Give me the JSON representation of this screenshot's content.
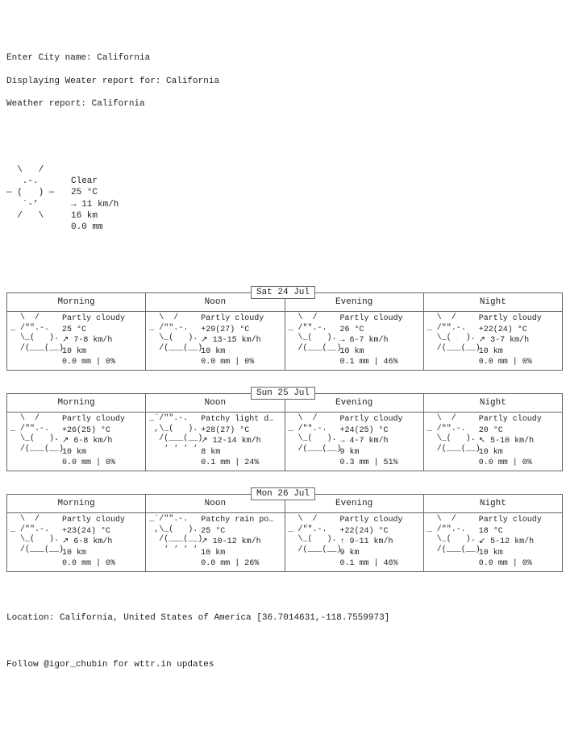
{
  "input_prompt": "Enter City name: ",
  "input_value": "California",
  "displaying_line": "Displaying Weater report for: California",
  "report_line": "Weather report: California",
  "current": {
    "art_lines": [
      "  \\   /",
      "   .-.",
      "― (   ) ―",
      "   `-’",
      "  /   \\"
    ],
    "cond": "Clear",
    "temp": "25 °C",
    "wind": "→ 11 km/h",
    "vis": "16 km",
    "precip": "0.0 mm"
  },
  "period_labels": [
    "Morning",
    "Noon",
    "Evening",
    "Night"
  ],
  "art_partly": [
    "  \\  /",
    "_ /\"\".-.",
    "  \\_(   ).",
    "  /(___(__)"
  ],
  "art_patchy": [
    "_`/\"\".-.",
    " ,\\_(   ).",
    "  /(___(__)",
    "   ‘ ‘ ‘ ‘"
  ],
  "days": [
    {
      "date": "Sat 24 Jul",
      "periods": [
        {
          "art": "partly",
          "cond": "Partly cloudy",
          "temp": "25 °C",
          "wind": "↗ 7-8 km/h",
          "vis": "10 km",
          "precip": "0.0 mm | 0%"
        },
        {
          "art": "partly",
          "cond": "Partly cloudy",
          "temp": "+29(27) °C",
          "wind": "↗ 13-15 km/h",
          "vis": "10 km",
          "precip": "0.0 mm | 0%"
        },
        {
          "art": "partly",
          "cond": "Partly cloudy",
          "temp": "26 °C",
          "wind": "→ 6-7 km/h",
          "vis": "10 km",
          "precip": "0.1 mm | 46%"
        },
        {
          "art": "partly",
          "cond": "Partly cloudy",
          "temp": "+22(24) °C",
          "wind": "↗ 3-7 km/h",
          "vis": "10 km",
          "precip": "0.0 mm | 0%"
        }
      ]
    },
    {
      "date": "Sun 25 Jul",
      "periods": [
        {
          "art": "partly",
          "cond": "Partly cloudy",
          "temp": "+26(25) °C",
          "wind": "↗ 6-8 km/h",
          "vis": "10 km",
          "precip": "0.0 mm | 0%"
        },
        {
          "art": "patchy",
          "cond": "Patchy light d…",
          "temp": "+28(27) °C",
          "wind": "↗ 12-14 km/h",
          "vis": "8 km",
          "precip": "0.1 mm | 24%"
        },
        {
          "art": "partly",
          "cond": "Partly cloudy",
          "temp": "+24(25) °C",
          "wind": "→ 4-7 km/h",
          "vis": "9 km",
          "precip": "0.3 mm | 51%"
        },
        {
          "art": "partly",
          "cond": "Partly cloudy",
          "temp": "20 °C",
          "wind": "↖ 5-10 km/h",
          "vis": "10 km",
          "precip": "0.0 mm | 0%"
        }
      ]
    },
    {
      "date": "Mon 26 Jul",
      "periods": [
        {
          "art": "partly",
          "cond": "Partly cloudy",
          "temp": "+23(24) °C",
          "wind": "↗ 6-8 km/h",
          "vis": "10 km",
          "precip": "0.0 mm | 0%"
        },
        {
          "art": "patchy",
          "cond": "Patchy rain po…",
          "temp": "25 °C",
          "wind": "↗ 10-12 km/h",
          "vis": "10 km",
          "precip": "0.0 mm | 26%"
        },
        {
          "art": "partly",
          "cond": "Partly cloudy",
          "temp": "+22(24) °C",
          "wind": "↑ 9-11 km/h",
          "vis": "9 km",
          "precip": "0.1 mm | 46%"
        },
        {
          "art": "partly",
          "cond": "Partly cloudy",
          "temp": "18 °C",
          "wind": "↙ 5-12 km/h",
          "vis": "10 km",
          "precip": "0.0 mm | 0%"
        }
      ]
    }
  ],
  "location_line": "Location: California, United States of America [36.7014631,-118.7559973]",
  "follow_line": "Follow @igor_chubin for wttr.in updates"
}
